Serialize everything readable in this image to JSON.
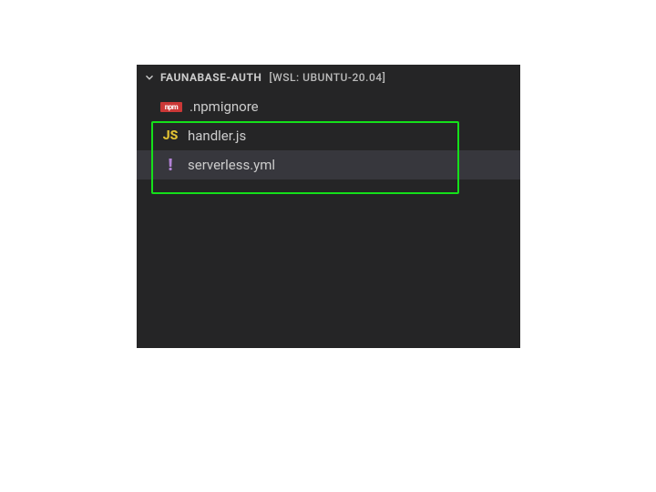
{
  "explorer": {
    "header": {
      "project_name": "FAUNABASE-AUTH",
      "context_suffix": "[WSL: UBUNTU-20.04]"
    },
    "files": [
      {
        "icon": "npm",
        "icon_text": "npm",
        "name": ".npmignore",
        "selected": false
      },
      {
        "icon": "js",
        "icon_text": "JS",
        "name": "handler.js",
        "selected": false
      },
      {
        "icon": "yaml",
        "icon_text": "!",
        "name": "serverless.yml",
        "selected": true
      }
    ]
  }
}
